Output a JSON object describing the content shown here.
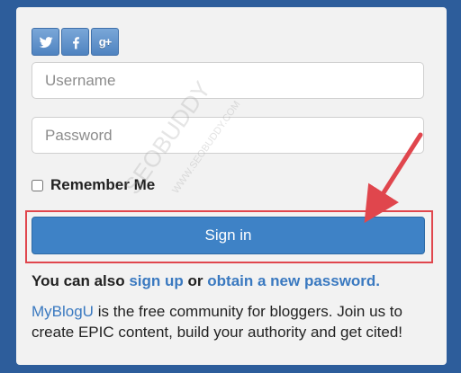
{
  "social": {
    "twitter_icon": "twitter-icon",
    "facebook_icon": "facebook-icon",
    "googleplus_icon": "google-plus-icon",
    "googleplus_glyph": "g+",
    "brand_color": "#4f83c0"
  },
  "form": {
    "username_placeholder": "Username",
    "password_placeholder": "Password",
    "remember_label": "Remember Me",
    "signin_label": "Sign in"
  },
  "footer": {
    "also_prefix": "You can also",
    "signup_link": "sign up",
    "or_text": "or",
    "obtain_link": "obtain a new password.",
    "brand_link": "MyBlogU",
    "description": "is the free community for bloggers. Join us to create EPIC content, build your authority and get cited!"
  },
  "watermark": {
    "text": "SEOBUDDY",
    "url_text": "WWW.SEOBUDDY.COM"
  },
  "colors": {
    "background": "#2d5d9b",
    "panel": "#f2f2f2",
    "button": "#3e82c6",
    "link": "#3a79c0",
    "highlight": "#e0464d"
  }
}
